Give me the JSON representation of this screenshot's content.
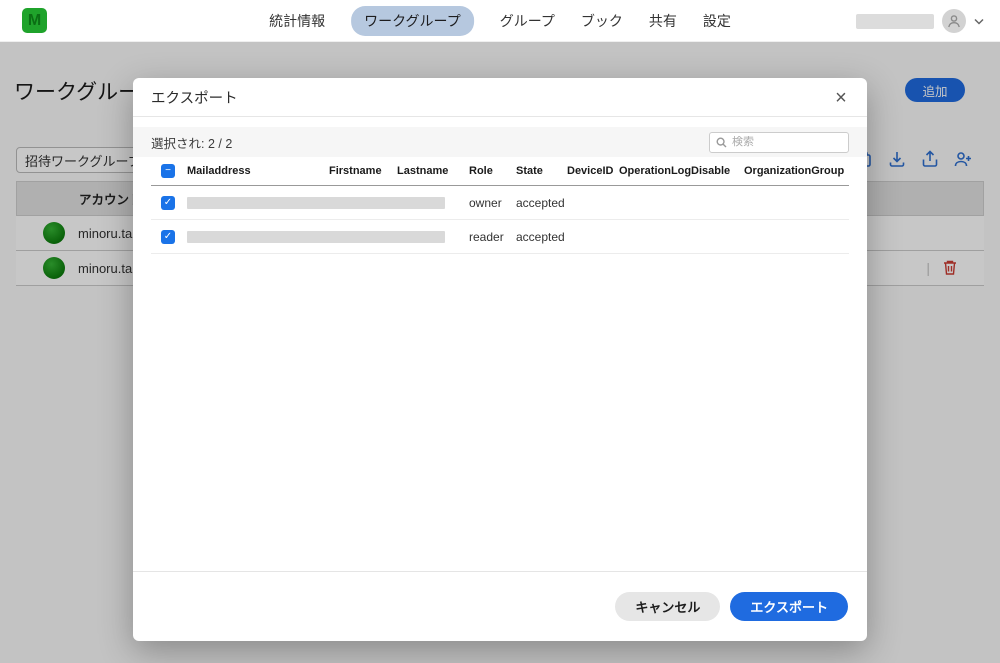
{
  "topnav": {
    "items": [
      {
        "label": "統計情報",
        "active": false
      },
      {
        "label": "ワークグループ",
        "active": true
      },
      {
        "label": "グループ",
        "active": false
      },
      {
        "label": "ブック",
        "active": false
      },
      {
        "label": "共有",
        "active": false
      },
      {
        "label": "設定",
        "active": false
      }
    ]
  },
  "page": {
    "title": "ワークグループ",
    "add_button_label": "追加",
    "invite_input_value": "招待ワークグループ（",
    "table": {
      "header": "アカウント",
      "rows": [
        {
          "name": "minoru.tan"
        },
        {
          "name": "minoru.tan"
        }
      ]
    }
  },
  "modal": {
    "title": "エクスポート",
    "selection_summary": "選択され: 2 / 2",
    "search_placeholder": "検索",
    "columns": [
      "Mailaddress",
      "Firstname",
      "Lastname",
      "Role",
      "State",
      "DeviceID",
      "OperationLog",
      "Disable",
      "OrganizationGroup"
    ],
    "rows": [
      {
        "role": "owner",
        "state": "accepted"
      },
      {
        "role": "reader",
        "state": "accepted"
      }
    ],
    "cancel_label": "キャンセル",
    "export_label": "エクスポート"
  },
  "icons": {
    "close": "×",
    "check": "✓",
    "minus": "−",
    "divider": "|",
    "logo_letter": "M"
  },
  "colors": {
    "accent": "#1f6be0",
    "checkbox_blue": "#1a73e8",
    "nav_active_bg": "#b6c8df",
    "logo_green": "#1fa32b",
    "avatar_green": "#0b7a0b",
    "danger_red": "#cc3b32"
  }
}
